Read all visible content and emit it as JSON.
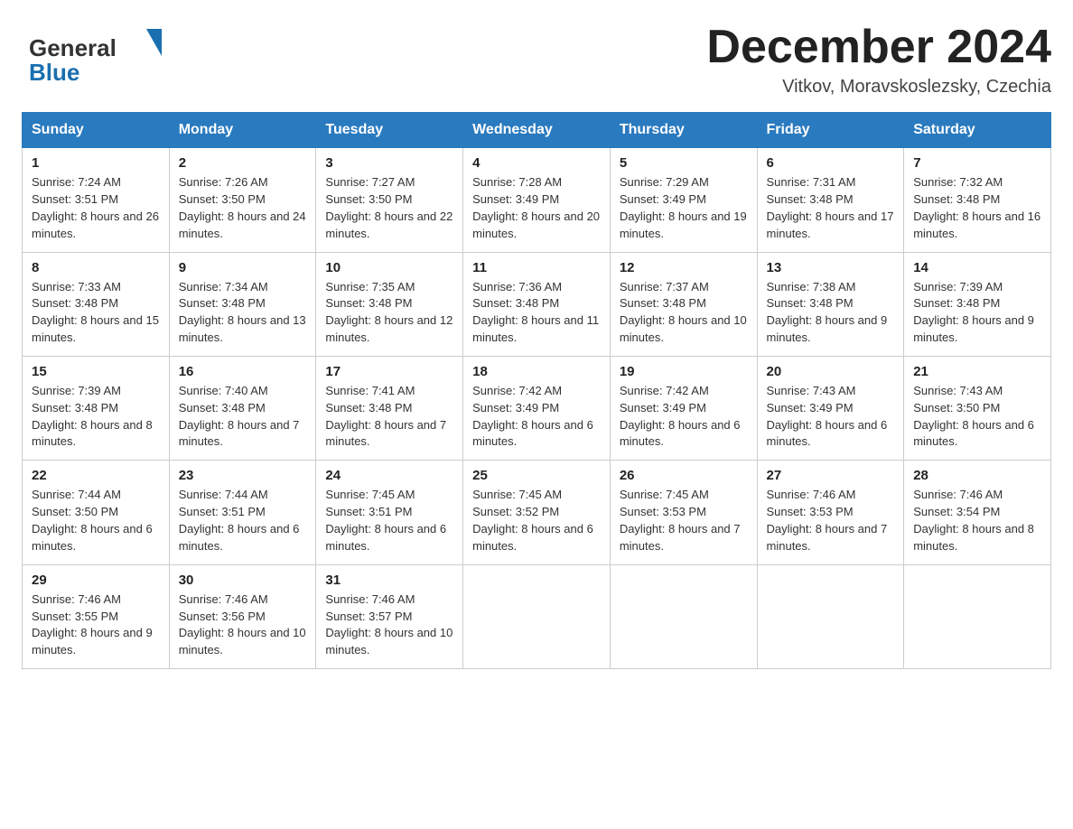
{
  "header": {
    "month_title": "December 2024",
    "location": "Vitkov, Moravskoslezsky, Czechia"
  },
  "days_of_week": [
    "Sunday",
    "Monday",
    "Tuesday",
    "Wednesday",
    "Thursday",
    "Friday",
    "Saturday"
  ],
  "weeks": [
    [
      {
        "day": "1",
        "sunrise": "7:24 AM",
        "sunset": "3:51 PM",
        "daylight": "8 hours and 26 minutes."
      },
      {
        "day": "2",
        "sunrise": "7:26 AM",
        "sunset": "3:50 PM",
        "daylight": "8 hours and 24 minutes."
      },
      {
        "day": "3",
        "sunrise": "7:27 AM",
        "sunset": "3:50 PM",
        "daylight": "8 hours and 22 minutes."
      },
      {
        "day": "4",
        "sunrise": "7:28 AM",
        "sunset": "3:49 PM",
        "daylight": "8 hours and 20 minutes."
      },
      {
        "day": "5",
        "sunrise": "7:29 AM",
        "sunset": "3:49 PM",
        "daylight": "8 hours and 19 minutes."
      },
      {
        "day": "6",
        "sunrise": "7:31 AM",
        "sunset": "3:48 PM",
        "daylight": "8 hours and 17 minutes."
      },
      {
        "day": "7",
        "sunrise": "7:32 AM",
        "sunset": "3:48 PM",
        "daylight": "8 hours and 16 minutes."
      }
    ],
    [
      {
        "day": "8",
        "sunrise": "7:33 AM",
        "sunset": "3:48 PM",
        "daylight": "8 hours and 15 minutes."
      },
      {
        "day": "9",
        "sunrise": "7:34 AM",
        "sunset": "3:48 PM",
        "daylight": "8 hours and 13 minutes."
      },
      {
        "day": "10",
        "sunrise": "7:35 AM",
        "sunset": "3:48 PM",
        "daylight": "8 hours and 12 minutes."
      },
      {
        "day": "11",
        "sunrise": "7:36 AM",
        "sunset": "3:48 PM",
        "daylight": "8 hours and 11 minutes."
      },
      {
        "day": "12",
        "sunrise": "7:37 AM",
        "sunset": "3:48 PM",
        "daylight": "8 hours and 10 minutes."
      },
      {
        "day": "13",
        "sunrise": "7:38 AM",
        "sunset": "3:48 PM",
        "daylight": "8 hours and 9 minutes."
      },
      {
        "day": "14",
        "sunrise": "7:39 AM",
        "sunset": "3:48 PM",
        "daylight": "8 hours and 9 minutes."
      }
    ],
    [
      {
        "day": "15",
        "sunrise": "7:39 AM",
        "sunset": "3:48 PM",
        "daylight": "8 hours and 8 minutes."
      },
      {
        "day": "16",
        "sunrise": "7:40 AM",
        "sunset": "3:48 PM",
        "daylight": "8 hours and 7 minutes."
      },
      {
        "day": "17",
        "sunrise": "7:41 AM",
        "sunset": "3:48 PM",
        "daylight": "8 hours and 7 minutes."
      },
      {
        "day": "18",
        "sunrise": "7:42 AM",
        "sunset": "3:49 PM",
        "daylight": "8 hours and 6 minutes."
      },
      {
        "day": "19",
        "sunrise": "7:42 AM",
        "sunset": "3:49 PM",
        "daylight": "8 hours and 6 minutes."
      },
      {
        "day": "20",
        "sunrise": "7:43 AM",
        "sunset": "3:49 PM",
        "daylight": "8 hours and 6 minutes."
      },
      {
        "day": "21",
        "sunrise": "7:43 AM",
        "sunset": "3:50 PM",
        "daylight": "8 hours and 6 minutes."
      }
    ],
    [
      {
        "day": "22",
        "sunrise": "7:44 AM",
        "sunset": "3:50 PM",
        "daylight": "8 hours and 6 minutes."
      },
      {
        "day": "23",
        "sunrise": "7:44 AM",
        "sunset": "3:51 PM",
        "daylight": "8 hours and 6 minutes."
      },
      {
        "day": "24",
        "sunrise": "7:45 AM",
        "sunset": "3:51 PM",
        "daylight": "8 hours and 6 minutes."
      },
      {
        "day": "25",
        "sunrise": "7:45 AM",
        "sunset": "3:52 PM",
        "daylight": "8 hours and 6 minutes."
      },
      {
        "day": "26",
        "sunrise": "7:45 AM",
        "sunset": "3:53 PM",
        "daylight": "8 hours and 7 minutes."
      },
      {
        "day": "27",
        "sunrise": "7:46 AM",
        "sunset": "3:53 PM",
        "daylight": "8 hours and 7 minutes."
      },
      {
        "day": "28",
        "sunrise": "7:46 AM",
        "sunset": "3:54 PM",
        "daylight": "8 hours and 8 minutes."
      }
    ],
    [
      {
        "day": "29",
        "sunrise": "7:46 AM",
        "sunset": "3:55 PM",
        "daylight": "8 hours and 9 minutes."
      },
      {
        "day": "30",
        "sunrise": "7:46 AM",
        "sunset": "3:56 PM",
        "daylight": "8 hours and 10 minutes."
      },
      {
        "day": "31",
        "sunrise": "7:46 AM",
        "sunset": "3:57 PM",
        "daylight": "8 hours and 10 minutes."
      },
      null,
      null,
      null,
      null
    ]
  ]
}
